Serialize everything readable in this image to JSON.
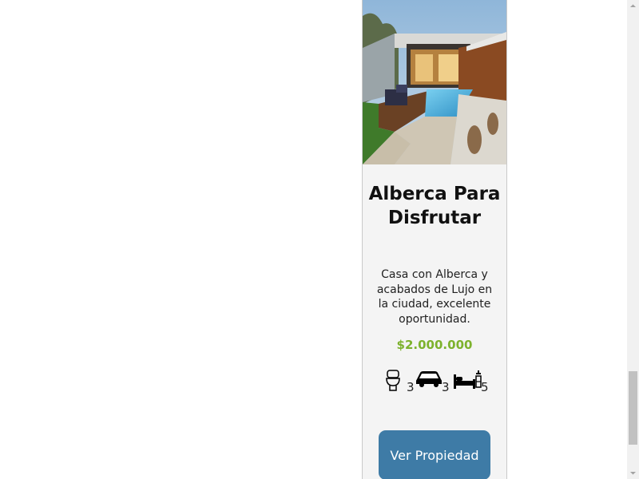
{
  "property": {
    "title": "Alberca Para Disfrutar",
    "description": "Casa con Alberca y acabados de Lujo en la ciudad, excelente oportunidad.",
    "price": "$2.000.000",
    "features": [
      {
        "icon": "toilet-icon",
        "count": "3"
      },
      {
        "icon": "car-icon",
        "count": "3"
      },
      {
        "icon": "bed-icon",
        "count": "5"
      }
    ],
    "button_label": "Ver Propiedad"
  },
  "colors": {
    "price": "#7db22d",
    "button": "#3e7ba6",
    "card_background": "#f4f4f4"
  }
}
